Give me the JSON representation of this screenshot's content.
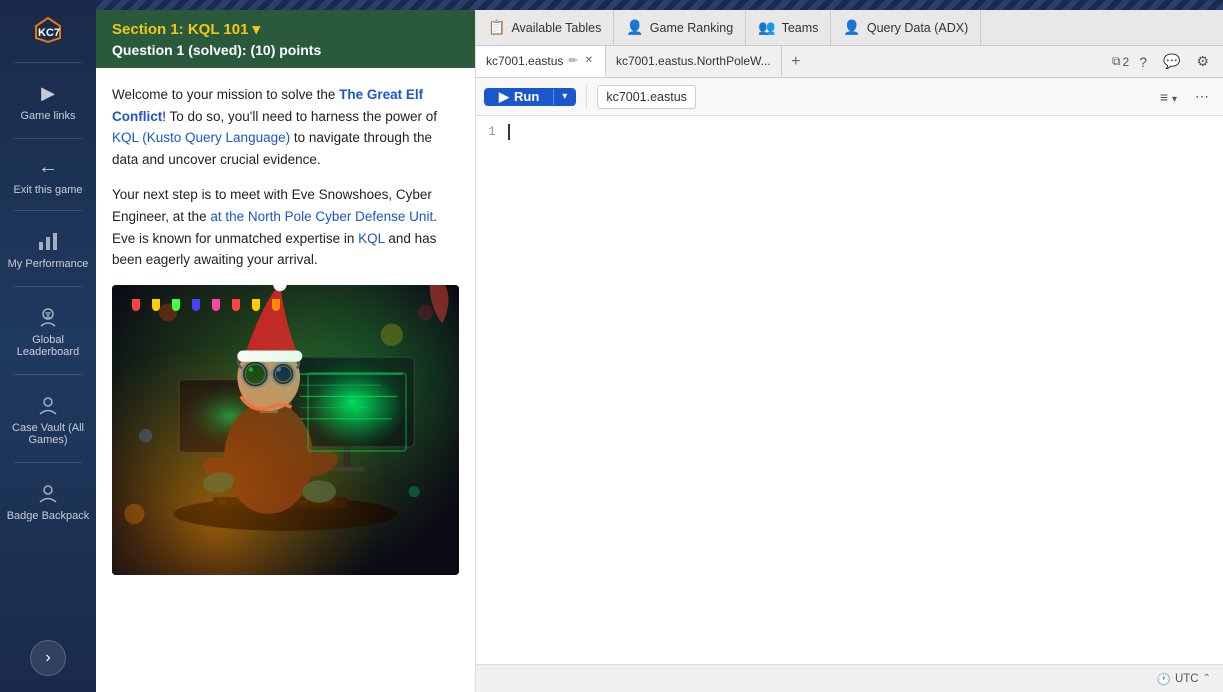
{
  "app": {
    "logo_text": "KC7",
    "top_stripe": true
  },
  "sidebar": {
    "items": [
      {
        "id": "game-links",
        "label": "Game links",
        "icon": "▶"
      },
      {
        "id": "exit-game",
        "label": "Exit this game",
        "icon": "←"
      },
      {
        "id": "my-performance",
        "label": "My Performance",
        "icon": "📊"
      },
      {
        "id": "global-leaderboard",
        "label": "Global Leaderboard",
        "icon": "🏆"
      },
      {
        "id": "case-vault",
        "label": "Case Vault (All Games)",
        "icon": "👤"
      },
      {
        "id": "badge-backpack",
        "label": "Badge Backpack",
        "icon": "👤"
      }
    ],
    "expand_button_label": "›"
  },
  "left_panel": {
    "section_title": "Section 1: KQL 101",
    "section_dropdown_icon": "▼",
    "question_info": "Question 1 (solved):   (10) points",
    "paragraphs": [
      {
        "id": "p1",
        "text": "Welcome to your mission to solve the The Great Elf Conflict! To do so, you'll need to harness the power of KQL (Kusto Query Language) to navigate through the data and uncover crucial evidence."
      },
      {
        "id": "p2",
        "text": "Your next step is to meet with Eve Snowshoes, Cyber Engineer, at the at the North Pole Cyber Defense Unit. Eve is known for unmatched expertise in KQL and has been eagerly awaiting your arrival."
      }
    ],
    "highlights": [
      "The Great Elf Conflict",
      "KQL (Kusto Query Language)",
      "at the North Pole Cyber Defense Unit",
      "KQL"
    ],
    "image_alt": "Sci-fi elf cyber engineer at computer"
  },
  "right_panel": {
    "tabs": [
      {
        "id": "available-tables",
        "label": "Available Tables",
        "icon": "📋"
      },
      {
        "id": "game-ranking",
        "label": "Game Ranking",
        "icon": "👤"
      },
      {
        "id": "teams",
        "label": "Teams",
        "icon": "👥"
      },
      {
        "id": "query-data",
        "label": "Query Data (ADX)",
        "icon": "👤"
      }
    ],
    "query_tabs": [
      {
        "id": "tab1",
        "label": "kc7001.eastus",
        "closable": true
      },
      {
        "id": "tab2",
        "label": "kc7001.eastus.NorthPoleW...",
        "closable": false
      }
    ],
    "add_tab_label": "+",
    "tab_right_controls": {
      "copy_count": "2",
      "help_label": "?",
      "feedback_label": "💬",
      "settings_label": "⚙"
    },
    "toolbar": {
      "run_label": "Run",
      "run_icon": "▶",
      "cluster_label": "kc7001.eastus",
      "share_icon": "≡",
      "more_icon": "⋯"
    },
    "editor": {
      "line_1": "1",
      "placeholder": ""
    },
    "status_bar": {
      "utc_label": "UTC",
      "utc_icon": "🕐",
      "collapse_icon": "⌃"
    }
  },
  "colors": {
    "sidebar_bg": "#1a2a4a",
    "section_header_bg": "#2a5a3c",
    "section_title_color": "#f5c518",
    "run_button_bg": "#1a56cc",
    "link_color": "#1a56cc"
  }
}
